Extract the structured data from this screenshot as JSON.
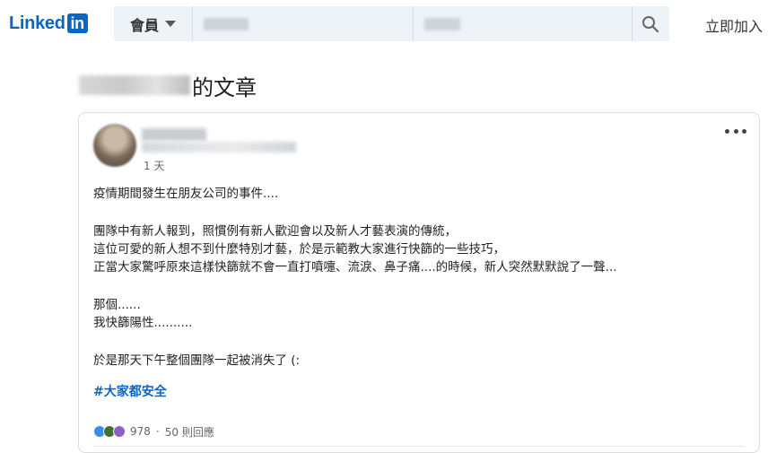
{
  "header": {
    "logo_text": "Linked",
    "logo_in": "in",
    "member_label": "會員",
    "join_label": "立即加入"
  },
  "page": {
    "title_suffix": "的文章"
  },
  "post": {
    "time": "1 天",
    "lines": [
      "疫情期間發生在朋友公司的事件....",
      "",
      "團隊中有新人報到，照慣例有新人歡迎會以及新人才藝表演的傳統，",
      "這位可愛的新人想不到什麼特別才藝，於是示範教大家進行快篩的一些技巧，",
      "正當大家驚呼原來這樣快篩就不會一直打噴嚏、流淚、鼻子痛....的時候，新人突然默默說了一聲...",
      "",
      "那個......",
      "我快篩陽性..........",
      "",
      "於是那天下午整個團隊一起被消失了 (:"
    ],
    "hashtag": "#大家都安全",
    "reaction_count": "978",
    "separator": "·",
    "comments": "50 則回應"
  },
  "colors": {
    "brand": "#0a66c2",
    "search_bg": "#eef3f8"
  }
}
